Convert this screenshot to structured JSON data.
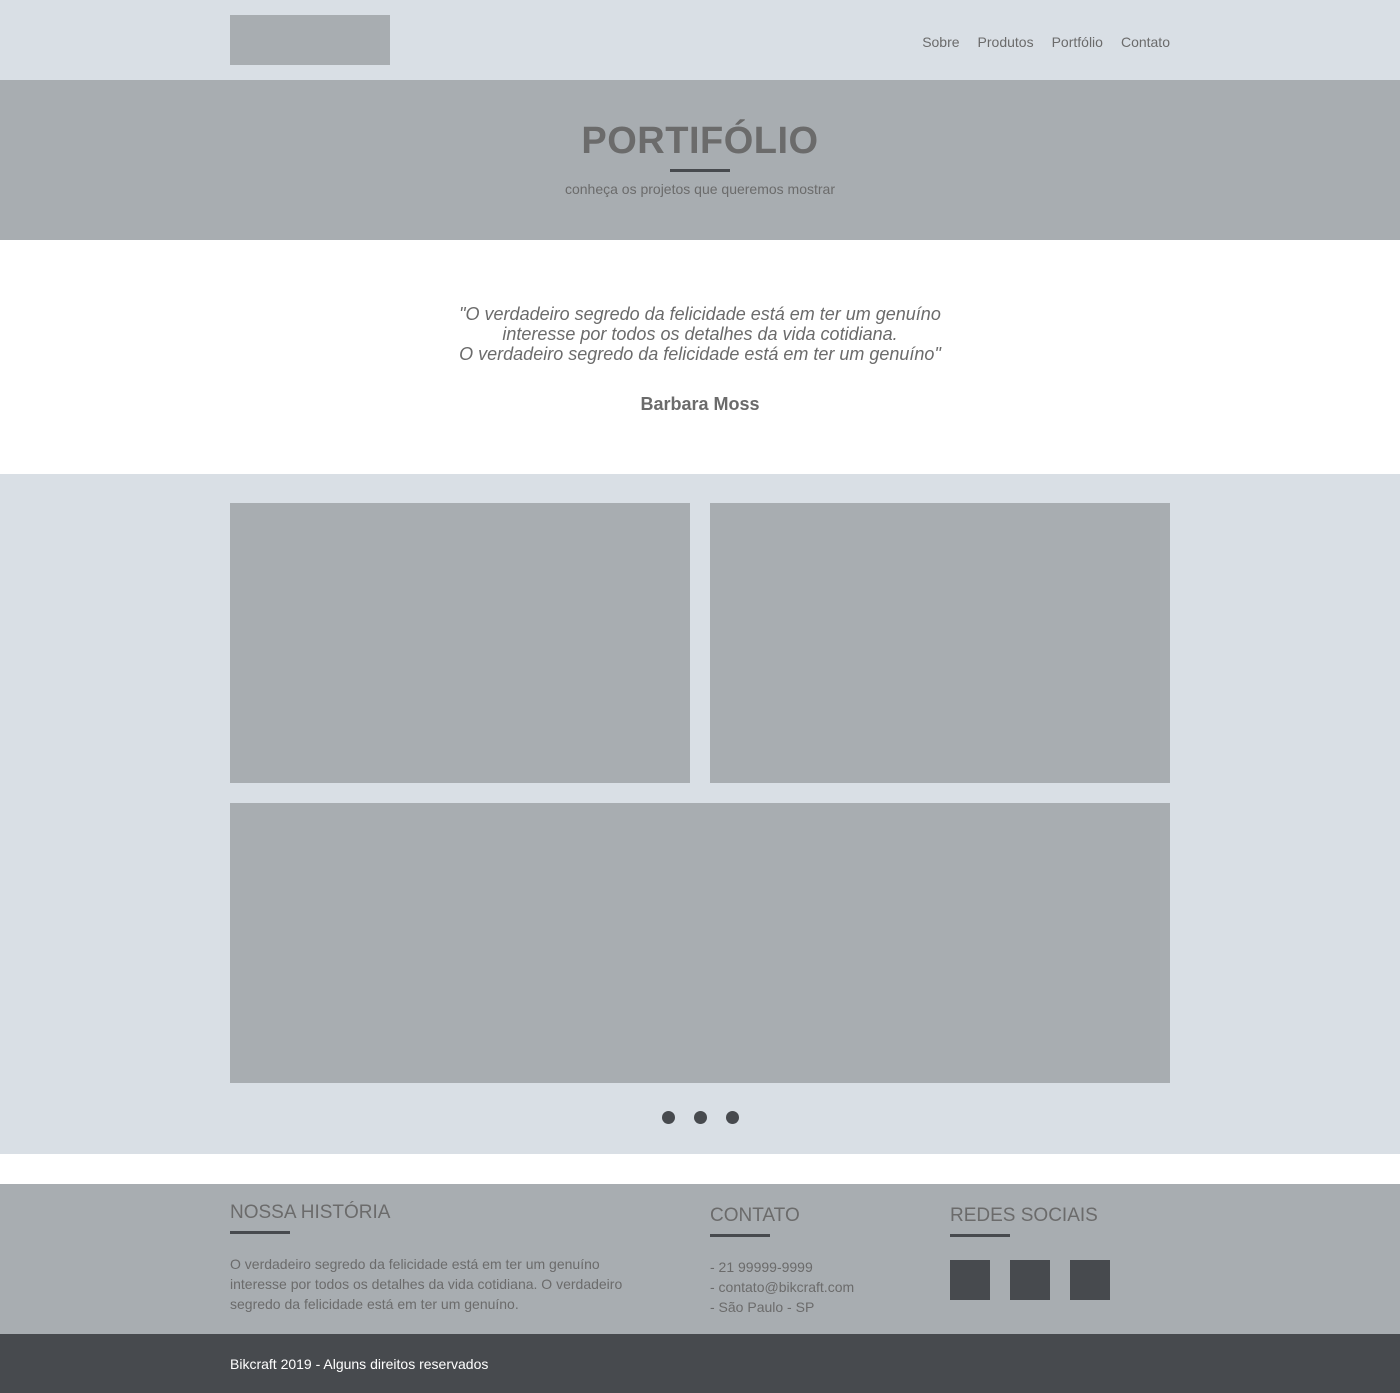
{
  "header": {
    "nav": [
      "Sobre",
      "Produtos",
      "Portfólio",
      "Contato"
    ]
  },
  "hero": {
    "title": "PORTIFÓLIO",
    "subtitle": "conheça os projetos que queremos mostrar"
  },
  "quote": {
    "lines": [
      "\"O verdadeiro segredo da felicidade está em ter um genuíno",
      "interesse por todos os detalhes da vida cotidiana.",
      "O verdadeiro segredo da felicidade está em ter um genuíno\""
    ],
    "author": "Barbara Moss"
  },
  "footer": {
    "historia": {
      "title": "NOSSA HISTÓRIA",
      "text": "O verdadeiro segredo da felicidade está em ter um genuíno interesse por todos os detalhes da vida cotidiana. O verdadeiro segredo da felicidade está em ter um genuíno."
    },
    "contato": {
      "title": "CONTATO",
      "items": [
        "- 21 99999-9999",
        "- contato@bikcraft.com",
        "- São Paulo - SP"
      ]
    },
    "redes": {
      "title": "REDES SOCIAIS"
    }
  },
  "copyright": "Bikcraft 2019 - Alguns direitos reservados",
  "colors": {
    "light_bg": "#d9dfe5",
    "placeholder": "#a8adb1",
    "dark": "#474a4e",
    "text": "#6b6b6b"
  }
}
